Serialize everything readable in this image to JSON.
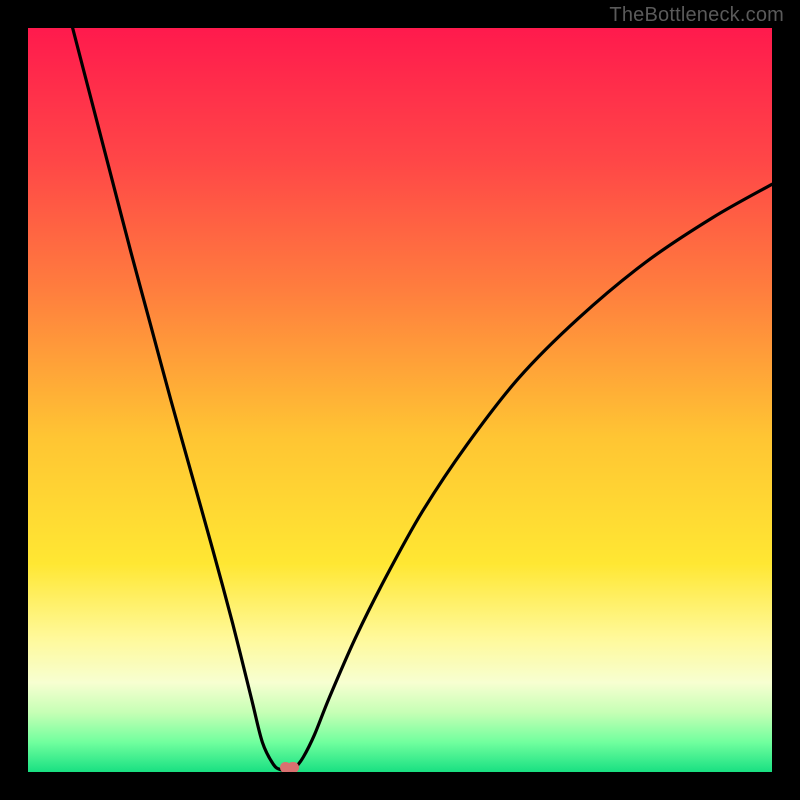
{
  "watermark": "TheBottleneck.com",
  "chart_data": {
    "type": "line",
    "title": "",
    "xlabel": "",
    "ylabel": "",
    "xlim": [
      0,
      100
    ],
    "ylim": [
      0,
      100
    ],
    "gradient_stops": [
      {
        "offset": 0,
        "color": "#ff1a4d"
      },
      {
        "offset": 18,
        "color": "#ff4747"
      },
      {
        "offset": 35,
        "color": "#ff7d3e"
      },
      {
        "offset": 55,
        "color": "#ffc533"
      },
      {
        "offset": 72,
        "color": "#ffe733"
      },
      {
        "offset": 82,
        "color": "#fff99a"
      },
      {
        "offset": 88,
        "color": "#f7ffd1"
      },
      {
        "offset": 92,
        "color": "#c6ffb5"
      },
      {
        "offset": 96,
        "color": "#71ff9e"
      },
      {
        "offset": 100,
        "color": "#18e082"
      }
    ],
    "series": [
      {
        "name": "bottleneck-curve",
        "points": [
          {
            "x": 6.0,
            "y": 100.0
          },
          {
            "x": 8.6,
            "y": 90.0
          },
          {
            "x": 11.2,
            "y": 80.0
          },
          {
            "x": 13.8,
            "y": 70.0
          },
          {
            "x": 16.5,
            "y": 60.0
          },
          {
            "x": 19.2,
            "y": 50.0
          },
          {
            "x": 22.0,
            "y": 40.0
          },
          {
            "x": 24.8,
            "y": 30.0
          },
          {
            "x": 27.5,
            "y": 20.0
          },
          {
            "x": 30.0,
            "y": 10.0
          },
          {
            "x": 31.5,
            "y": 4.0
          },
          {
            "x": 33.0,
            "y": 1.0
          },
          {
            "x": 34.0,
            "y": 0.3
          },
          {
            "x": 35.0,
            "y": 0.2
          },
          {
            "x": 36.0,
            "y": 0.7
          },
          {
            "x": 37.0,
            "y": 2.0
          },
          {
            "x": 38.5,
            "y": 5.0
          },
          {
            "x": 40.5,
            "y": 10.0
          },
          {
            "x": 44.0,
            "y": 18.0
          },
          {
            "x": 48.0,
            "y": 26.0
          },
          {
            "x": 53.0,
            "y": 35.0
          },
          {
            "x": 59.0,
            "y": 44.0
          },
          {
            "x": 66.0,
            "y": 53.0
          },
          {
            "x": 74.0,
            "y": 61.0
          },
          {
            "x": 83.0,
            "y": 68.5
          },
          {
            "x": 92.0,
            "y": 74.5
          },
          {
            "x": 100.0,
            "y": 79.0
          }
        ]
      }
    ],
    "markers": [
      {
        "x": 34.6,
        "y": 0.6,
        "r": 0.7
      },
      {
        "x": 35.6,
        "y": 0.6,
        "r": 0.8
      }
    ]
  }
}
